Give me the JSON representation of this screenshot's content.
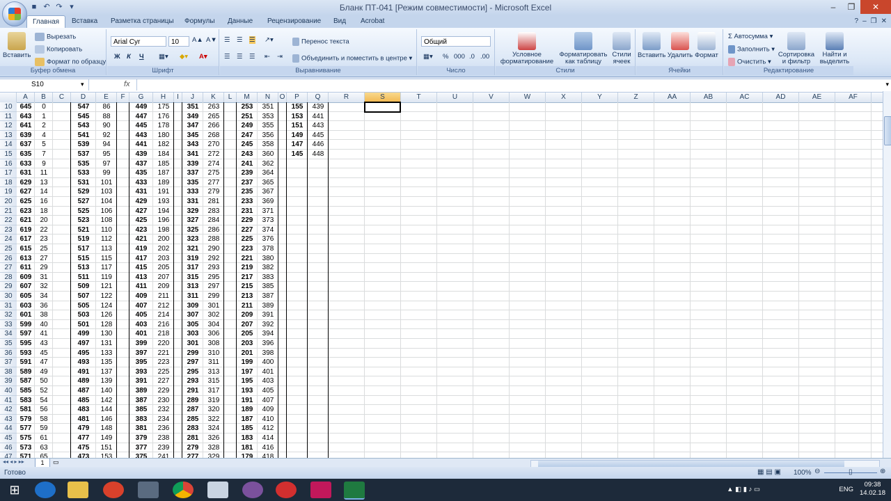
{
  "window": {
    "title": "Бланк ПТ-041  [Режим совместимости] - Microsoft Excel"
  },
  "tabs": [
    "Главная",
    "Вставка",
    "Разметка страницы",
    "Формулы",
    "Данные",
    "Рецензирование",
    "Вид",
    "Acrobat"
  ],
  "ribbon": {
    "clipboard": {
      "paste": "Вставить",
      "cut": "Вырезать",
      "copy": "Копировать",
      "format_painter": "Формат по образцу",
      "label": "Буфер обмена"
    },
    "font": {
      "name": "Arial Cyr",
      "size": "10",
      "bold": "Ж",
      "italic": "К",
      "underline": "Ч",
      "label": "Шрифт"
    },
    "alignment": {
      "wrap": "Перенос текста",
      "merge": "Объединить и поместить в центре",
      "label": "Выравнивание"
    },
    "number": {
      "format": "Общий",
      "percent": "%",
      "thousands": "000",
      "label": "Число"
    },
    "styles": {
      "conditional": "Условное форматирование",
      "as_table": "Форматировать как таблицу",
      "cell_styles": "Стили ячеек",
      "label": "Стили"
    },
    "cells": {
      "insert": "Вставить",
      "delete": "Удалить",
      "format": "Формат",
      "label": "Ячейки"
    },
    "editing": {
      "autosum": "Автосумма",
      "fill": "Заполнить",
      "clear": "Очистить",
      "sort": "Сортировка и фильтр",
      "find": "Найти и выделить",
      "label": "Редактирование"
    }
  },
  "formula_bar": {
    "name_box": "S10",
    "fx": "fx",
    "value": ""
  },
  "columns": [
    "A",
    "B",
    "C",
    "D",
    "E",
    "F",
    "G",
    "H",
    "I",
    "J",
    "K",
    "L",
    "M",
    "N",
    "O",
    "P",
    "Q",
    "R",
    "S",
    "T",
    "U",
    "V",
    "W",
    "X",
    "Y",
    "Z",
    "AA",
    "AB",
    "AC",
    "AD",
    "AE",
    "AF"
  ],
  "rows": [
    10,
    11,
    12,
    13,
    14,
    15,
    16,
    17,
    18,
    19,
    20,
    21,
    22,
    23,
    24,
    25,
    26,
    27,
    28,
    29,
    30,
    31,
    32,
    33,
    34,
    35,
    36,
    37,
    38,
    39,
    40,
    41,
    42,
    43,
    44,
    45,
    46,
    47
  ],
  "col_A": [
    645,
    643,
    641,
    639,
    637,
    635,
    633,
    631,
    629,
    627,
    625,
    623,
    621,
    619,
    617,
    615,
    613,
    611,
    609,
    607,
    605,
    603,
    601,
    599,
    597,
    595,
    593,
    591,
    589,
    587,
    585,
    583,
    581,
    579,
    577,
    575,
    573,
    571
  ],
  "col_B": [
    0,
    1,
    2,
    4,
    5,
    7,
    9,
    11,
    13,
    14,
    16,
    18,
    20,
    22,
    23,
    25,
    27,
    29,
    31,
    32,
    34,
    36,
    38,
    40,
    41,
    43,
    45,
    47,
    49,
    50,
    52,
    54,
    56,
    58,
    59,
    61,
    63,
    65
  ],
  "col_D": [
    547,
    545,
    543,
    541,
    539,
    537,
    535,
    533,
    531,
    529,
    527,
    525,
    523,
    521,
    519,
    517,
    515,
    513,
    511,
    509,
    507,
    505,
    503,
    501,
    499,
    497,
    495,
    493,
    491,
    489,
    487,
    485,
    483,
    481,
    479,
    477,
    475,
    473
  ],
  "col_E": [
    86,
    88,
    90,
    92,
    94,
    95,
    97,
    99,
    101,
    103,
    104,
    106,
    108,
    110,
    112,
    113,
    115,
    117,
    119,
    121,
    122,
    124,
    126,
    128,
    130,
    131,
    133,
    135,
    137,
    139,
    140,
    142,
    144,
    146,
    148,
    149,
    151,
    153
  ],
  "col_G": [
    449,
    447,
    445,
    443,
    441,
    439,
    437,
    435,
    433,
    431,
    429,
    427,
    425,
    423,
    421,
    419,
    417,
    415,
    413,
    411,
    409,
    407,
    405,
    403,
    401,
    399,
    397,
    395,
    393,
    391,
    389,
    387,
    385,
    383,
    381,
    379,
    377,
    375
  ],
  "col_H": [
    175,
    176,
    178,
    180,
    182,
    184,
    185,
    187,
    189,
    191,
    193,
    194,
    196,
    198,
    200,
    202,
    203,
    205,
    207,
    209,
    211,
    212,
    214,
    216,
    218,
    220,
    221,
    223,
    225,
    227,
    229,
    230,
    232,
    234,
    236,
    238,
    239,
    241
  ],
  "col_J": [
    351,
    349,
    347,
    345,
    343,
    341,
    339,
    337,
    335,
    333,
    331,
    329,
    327,
    325,
    323,
    321,
    319,
    317,
    315,
    313,
    311,
    309,
    307,
    305,
    303,
    301,
    299,
    297,
    295,
    293,
    291,
    289,
    287,
    285,
    283,
    281,
    279,
    277
  ],
  "col_K": [
    263,
    265,
    266,
    268,
    270,
    272,
    274,
    275,
    277,
    279,
    281,
    283,
    284,
    286,
    288,
    290,
    292,
    293,
    295,
    297,
    299,
    301,
    302,
    304,
    306,
    308,
    310,
    311,
    313,
    315,
    317,
    319,
    320,
    322,
    324,
    326,
    328,
    329
  ],
  "col_M": [
    253,
    251,
    249,
    247,
    245,
    243,
    241,
    239,
    237,
    235,
    233,
    231,
    229,
    227,
    225,
    223,
    221,
    219,
    217,
    215,
    213,
    211,
    209,
    207,
    205,
    203,
    201,
    199,
    197,
    195,
    193,
    191,
    189,
    187,
    185,
    183,
    181,
    179
  ],
  "col_N": [
    351,
    353,
    355,
    356,
    358,
    360,
    362,
    364,
    365,
    367,
    369,
    371,
    373,
    374,
    376,
    378,
    380,
    382,
    383,
    385,
    387,
    389,
    391,
    392,
    394,
    396,
    398,
    400,
    401,
    403,
    405,
    407,
    409,
    410,
    412,
    414,
    416,
    418
  ],
  "col_P": [
    155,
    153,
    151,
    149,
    147,
    145
  ],
  "col_Q": [
    439,
    441,
    443,
    445,
    446,
    448
  ],
  "sheet_tab": "1",
  "status": {
    "ready": "Готово",
    "zoom": "100%"
  },
  "taskbar": {
    "lang": "ENG",
    "time": "09:38",
    "date": "14.02.18"
  },
  "colors": {
    "accent": "#c4d5ec",
    "selected_header": "#f1b74f",
    "grid_line": "#dadcdd"
  }
}
